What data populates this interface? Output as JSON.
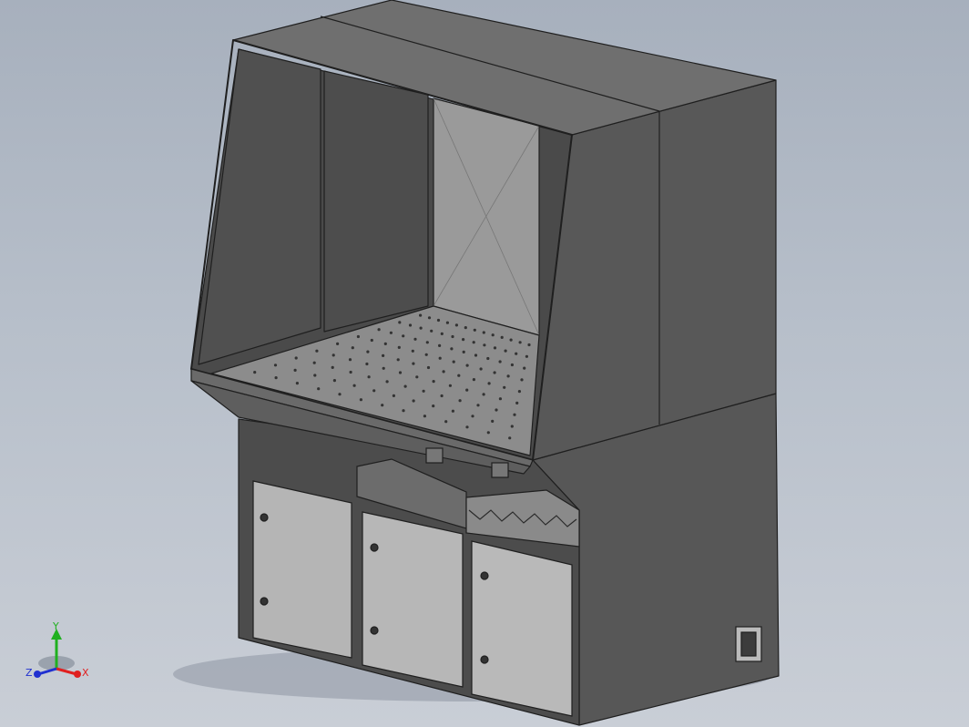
{
  "viewport": {
    "background_top": "#a7b0bd",
    "background_bottom": "#c9ced6"
  },
  "model": {
    "body_color": "#5b5b5b",
    "top_color": "#707070",
    "side_dark": "#4a4a4a",
    "door_color": "#b9b9b9",
    "perforated_color": "#8c8c8c",
    "edge_color": "#1f1f1f"
  },
  "triad": {
    "x_label": "X",
    "y_label": "Y",
    "z_label": "Z",
    "x_color": "#e02020",
    "y_color": "#20b020",
    "z_color": "#2030d0"
  }
}
